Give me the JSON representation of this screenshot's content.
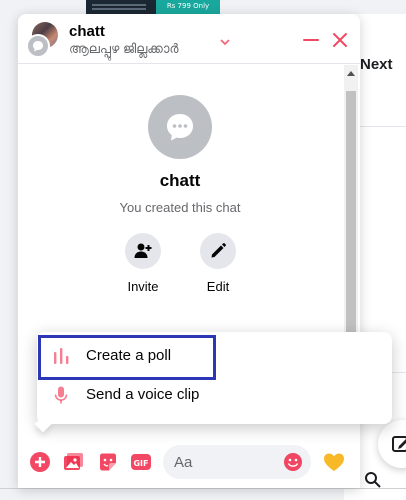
{
  "background": {
    "banner_badge": "Rs 799 Only",
    "next_label": "Next"
  },
  "chat": {
    "name": "chatt",
    "subtitle": "ആലപ്പുഴ ജില്ലക്കാർ",
    "profile": {
      "title": "chatt",
      "description": "You created this chat"
    },
    "actions": [
      {
        "label": "Invite",
        "icon": "add-person-icon"
      },
      {
        "label": "Edit",
        "icon": "pencil-icon"
      }
    ],
    "composer": {
      "placeholder": "Aa"
    }
  },
  "popup_menu": {
    "items": [
      {
        "label": "Create a poll",
        "icon": "poll-icon"
      },
      {
        "label": "Send a voice clip",
        "icon": "microphone-icon"
      }
    ]
  },
  "colors": {
    "accent": "#f02849",
    "highlight_border": "#2b37b5",
    "heart": "#f7b928"
  }
}
